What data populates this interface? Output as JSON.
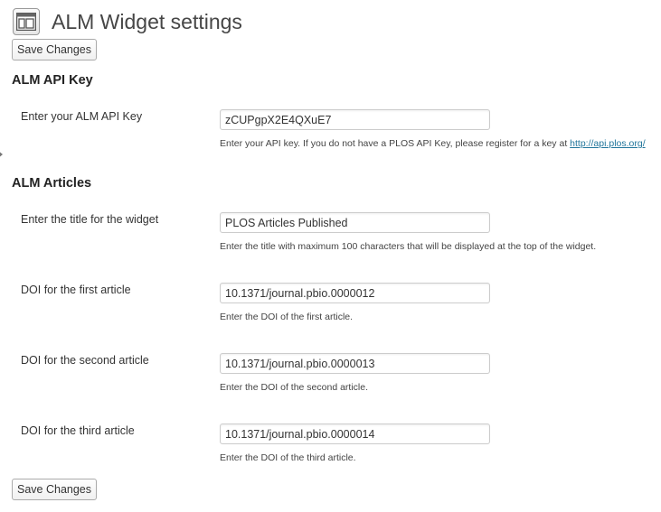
{
  "page": {
    "title": "ALM Widget settings",
    "icon": "widget-settings-icon"
  },
  "buttons": {
    "save_top": "Save Changes",
    "save_bottom": "Save Changes"
  },
  "api_section": {
    "title": "ALM API Key",
    "api_key": {
      "label": "Enter your ALM API Key",
      "value": "zCUPgpX2E4QXuE7",
      "description": "Enter your API key. If you do not have a PLOS API Key, please register for a key at",
      "link_text": "http://api.plos.org/"
    }
  },
  "articles_section": {
    "title": "ALM Articles",
    "widget_title": {
      "label": "Enter the title for the widget",
      "value": "PLOS Articles Published",
      "description": "Enter the title with maximum 100 characters that will be displayed at the top of the widget."
    },
    "doi_first": {
      "label": "DOI for the first article",
      "value": "10.1371/journal.pbio.0000012",
      "description": "Enter the DOI of the first article."
    },
    "doi_second": {
      "label": "DOI for the second article",
      "value": "10.1371/journal.pbio.0000013",
      "description": "Enter the DOI of the second article."
    },
    "doi_third": {
      "label": "DOI for the third article",
      "value": "10.1371/journal.pbio.0000014",
      "description": "Enter the DOI of the third article."
    }
  },
  "colors": {
    "link": "#21759b",
    "title": "#464646",
    "input_border": "#cccccc"
  }
}
